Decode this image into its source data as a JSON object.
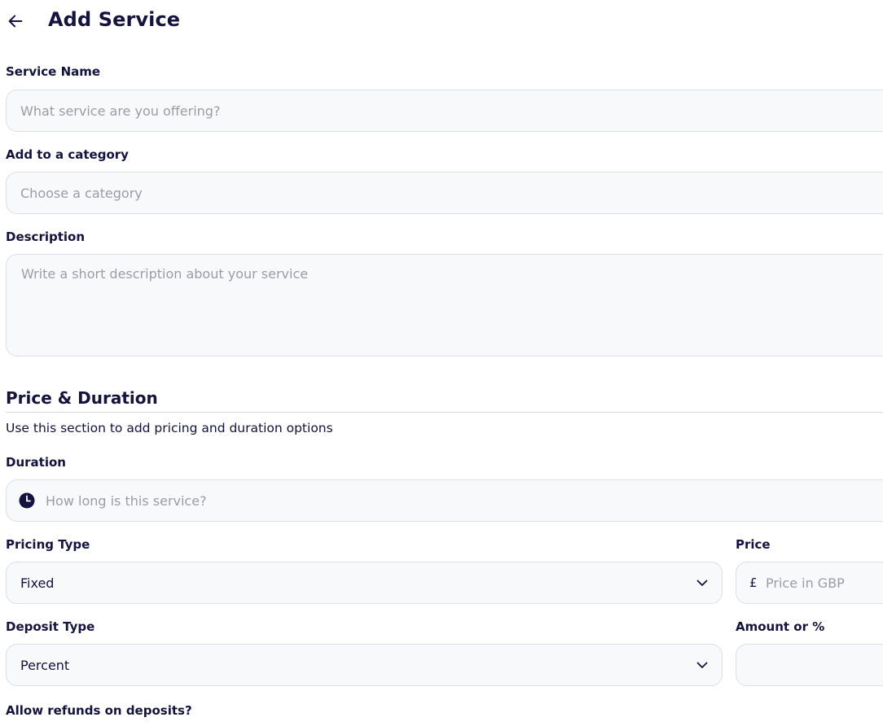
{
  "header": {
    "title": "Add Service",
    "back_icon": "arrow-left-icon"
  },
  "service_name": {
    "label": "Service Name",
    "placeholder": "What service are you offering?",
    "value": ""
  },
  "category": {
    "label": "Add to a category",
    "placeholder": "Choose a category",
    "value": ""
  },
  "description": {
    "label": "Description",
    "placeholder": "Write a short description about your service",
    "value": ""
  },
  "price_duration": {
    "title": "Price & Duration",
    "subtitle": "Use this section to add pricing and duration options"
  },
  "duration": {
    "label": "Duration",
    "placeholder": "How long is this service?",
    "icon": "clock-icon",
    "value": ""
  },
  "pricing_type": {
    "label": "Pricing Type",
    "selected": "Fixed",
    "icon": "chevron-down-icon"
  },
  "price": {
    "label": "Price",
    "currency_symbol": "£",
    "placeholder": "Price in GBP",
    "value": ""
  },
  "deposit_type": {
    "label": "Deposit Type",
    "selected": "Percent",
    "icon": "chevron-down-icon"
  },
  "amount": {
    "label": "Amount or %",
    "placeholder": "",
    "value": ""
  },
  "refunds": {
    "label": "Allow refunds on deposits?"
  },
  "colors": {
    "text": "#14123f",
    "placeholder": "#9a9ca8",
    "field_bg": "#f8f9fb",
    "field_border": "#dcdfe6"
  }
}
